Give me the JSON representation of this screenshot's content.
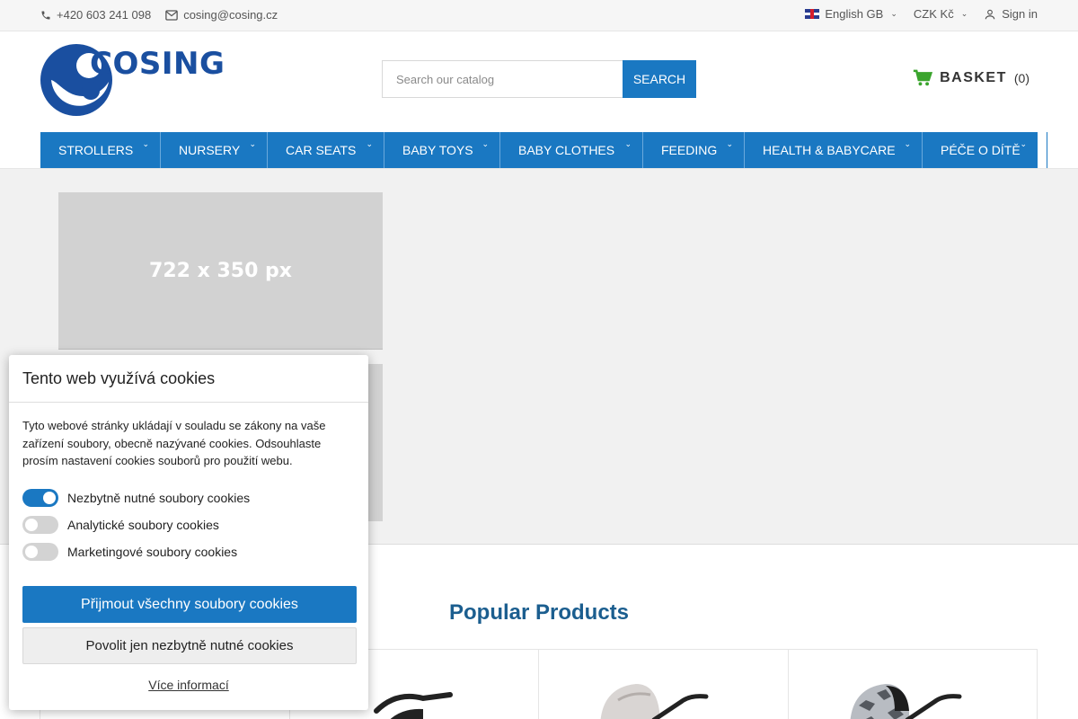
{
  "topbar": {
    "phone": "+420 603 241 098",
    "email": "cosing@cosing.cz",
    "language": "English GB",
    "currency": "CZK Kč",
    "sign_in": "Sign in"
  },
  "header": {
    "logo_text": "COSING",
    "search_placeholder": "Search our catalog",
    "search_button": "SEARCH",
    "basket_label": "BASKET",
    "basket_count": "(0)"
  },
  "nav": {
    "items": [
      {
        "label": "STROLLERS"
      },
      {
        "label": "NURSERY"
      },
      {
        "label": "CAR SEATS"
      },
      {
        "label": "BABY TOYS"
      },
      {
        "label": "BABY CLOTHES"
      },
      {
        "label": "FEEDING"
      },
      {
        "label": "HEALTH & BABYCARE"
      },
      {
        "label": "PÉČE O DÍTĚ"
      }
    ]
  },
  "banner": {
    "placeholder_text": "722 x 350 px"
  },
  "popular": {
    "title": "Popular Products"
  },
  "cookie": {
    "title": "Tento web využívá cookies",
    "description": "Tyto webové stránky ukládají v souladu se zákony na vaše zařízení soubory, obecně nazývané cookies. Odsouhlaste prosím nastavení cookies souborů pro použití webu.",
    "toggles": [
      {
        "label": "Nezbytně nutné soubory cookies",
        "enabled": true
      },
      {
        "label": "Analytické soubory cookies",
        "enabled": false
      },
      {
        "label": "Marketingové soubory cookies",
        "enabled": false
      }
    ],
    "accept_all": "Přijmout všechny soubory cookies",
    "allow_necessary": "Povolit jen nezbytně nutné cookies",
    "more_info": "Více informací"
  },
  "colors": {
    "primary": "#1a78c2",
    "basket_icon": "#3aa42d",
    "heading": "#1b5e8f"
  }
}
